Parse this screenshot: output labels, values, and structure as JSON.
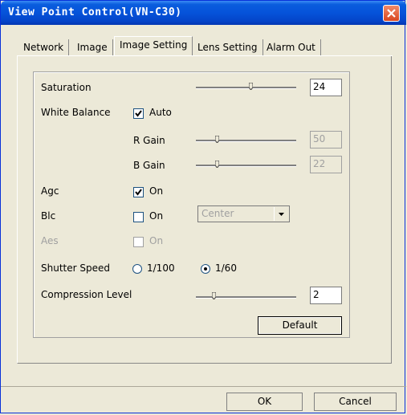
{
  "window": {
    "title": "View Point Control(VN-C30)"
  },
  "tabs": [
    {
      "label": "Network"
    },
    {
      "label": "Image"
    },
    {
      "label": "Image Setting"
    },
    {
      "label": "Lens Setting"
    },
    {
      "label": "Alarm Out"
    }
  ],
  "settings": {
    "saturation": {
      "label": "Saturation",
      "value": "24",
      "level": 0.55
    },
    "white_balance": {
      "label": "White Balance",
      "checkbox_label": "Auto",
      "checked": true
    },
    "r_gain": {
      "label": "R Gain",
      "value": "50",
      "level": 0.2
    },
    "b_gain": {
      "label": "B Gain",
      "value": "22",
      "level": 0.2
    },
    "agc": {
      "label": "Agc",
      "checkbox_label": "On",
      "checked": true
    },
    "blc": {
      "label": "Blc",
      "checkbox_label": "On",
      "checked": false,
      "select_value": "Center"
    },
    "aes": {
      "label": "Aes",
      "checkbox_label": "On",
      "checked": false
    },
    "shutter_speed": {
      "label": "Shutter Speed",
      "options": [
        "1/100",
        "1/60"
      ],
      "selected": "1/60"
    },
    "compression": {
      "label": "Compression Level",
      "value": "2",
      "level": 0.17
    }
  },
  "buttons": {
    "default": "Default",
    "ok": "OK",
    "cancel": "Cancel"
  },
  "colors": {
    "title_bar": "#0553da",
    "close_button": "#d9471f",
    "face": "#ece9d8"
  }
}
